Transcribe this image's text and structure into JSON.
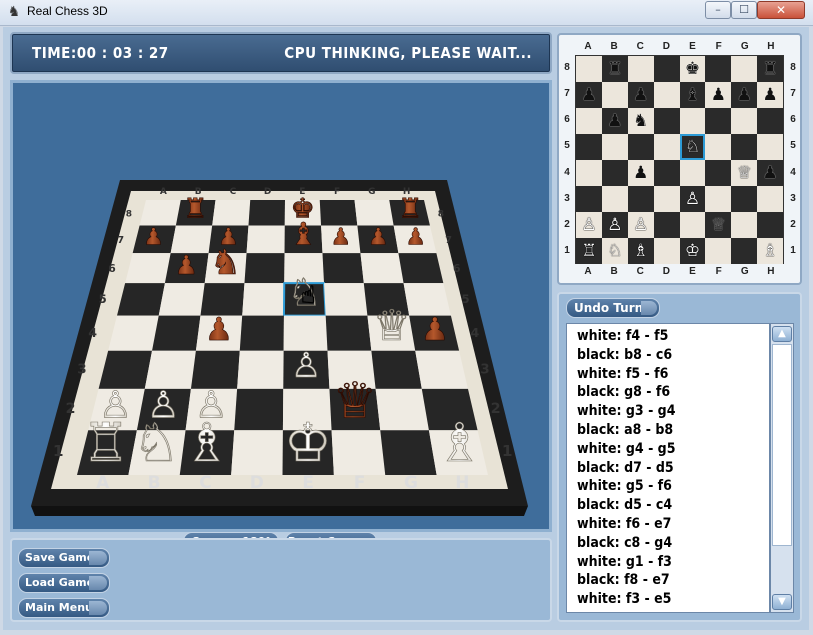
{
  "window": {
    "title": "Real Chess 3D",
    "app_icon": "chess-knight-icon",
    "min": "–",
    "max": "☐",
    "close": "✕"
  },
  "status_bar": {
    "time_label": "TIME:",
    "time_value": "00 : 03 : 27",
    "status": "CPU THINKING, PLEASE WAIT..."
  },
  "board3d": {
    "files": [
      "A",
      "B",
      "C",
      "D",
      "E",
      "F",
      "G",
      "H"
    ],
    "ranks": [
      "8",
      "7",
      "6",
      "5",
      "4",
      "3",
      "2",
      "1"
    ]
  },
  "camera": {
    "rotate_label": "Camera 180°",
    "reset_label": "Reset Camera"
  },
  "menu": {
    "save_label": "Save Game",
    "load_label": "Load Game",
    "main_menu_label": "Main Menu"
  },
  "board2d": {
    "files": [
      "A",
      "B",
      "C",
      "D",
      "E",
      "F",
      "G",
      "H"
    ],
    "ranks": [
      "8",
      "7",
      "6",
      "5",
      "4",
      "3",
      "2",
      "1"
    ],
    "rows": [
      [
        "",
        "♜",
        "",
        "",
        "♚",
        "",
        "",
        "♜"
      ],
      [
        "♟",
        "",
        "♟",
        "",
        "♝",
        "♟",
        "♟",
        "♟"
      ],
      [
        "",
        "♟",
        "♞",
        "",
        "",
        "",
        "",
        ""
      ],
      [
        "",
        "",
        "",
        "",
        "♘",
        "",
        "",
        ""
      ],
      [
        "",
        "",
        "♟",
        "",
        "",
        "",
        "♕",
        "♟"
      ],
      [
        "",
        "",
        "",
        "",
        "♙",
        "",
        "",
        ""
      ],
      [
        "♙",
        "♙",
        "♙",
        "",
        "",
        "♕",
        "",
        ""
      ],
      [
        "♖",
        "♘",
        "♗",
        "",
        "♔",
        "",
        "",
        "♗"
      ]
    ],
    "colors": [
      [
        "",
        "b",
        "",
        "",
        "b",
        "",
        "",
        "b"
      ],
      [
        "b",
        "",
        "b",
        "",
        "b",
        "b",
        "b",
        "b"
      ],
      [
        "",
        "b",
        "b",
        "",
        "",
        "",
        "",
        ""
      ],
      [
        "",
        "",
        "",
        "",
        "w",
        "",
        "",
        ""
      ],
      [
        "",
        "",
        "b",
        "",
        "",
        "",
        "w",
        "b"
      ],
      [
        "",
        "",
        "",
        "",
        "w",
        "",
        "",
        ""
      ],
      [
        "w",
        "w",
        "w",
        "",
        "",
        "b",
        "",
        ""
      ],
      [
        "w",
        "w",
        "w",
        "",
        "w",
        "",
        "",
        "w"
      ]
    ],
    "highlight": "e5"
  },
  "moves": {
    "undo_label": "Undo Turn",
    "list": [
      "white: f4 - f5",
      "black: b8 - c6",
      "white: f5 - f6",
      "black: g8 - f6",
      "white: g3 - g4",
      "black: a8 - b8",
      "white: g4 - g5",
      "black: d7 - d5",
      "white: g5 - f6",
      "black: d5 - c4",
      "white: f6 - e7",
      "black: c8 - g4",
      "white: g1 - f3",
      "black: f8 - e7",
      "white: f3 - e5"
    ],
    "scroll_up_icon": "▲",
    "scroll_down_icon": "▼"
  },
  "colors": {
    "panel": "#9ab8d6",
    "viewport_bg": "#3f6d9b",
    "button": "#345983"
  }
}
